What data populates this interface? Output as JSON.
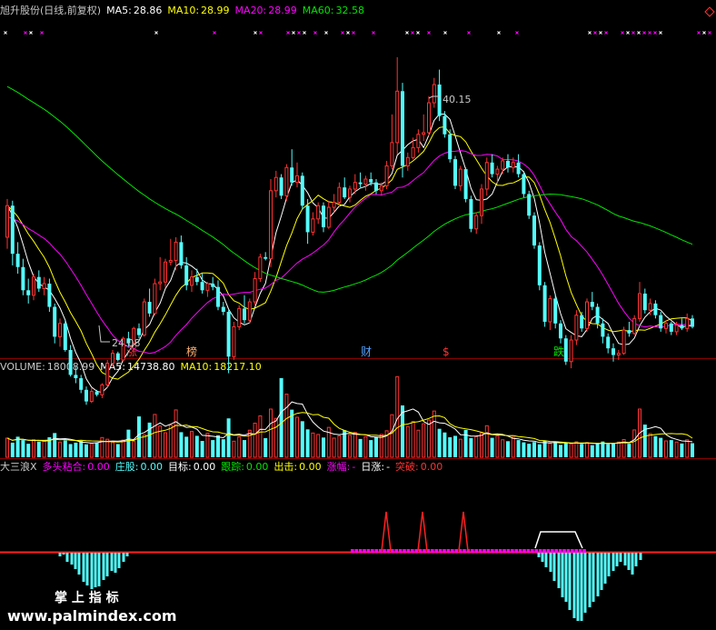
{
  "main": {
    "title": "旭升股份(日线,前复权)",
    "ma5_label": "MA5:",
    "ma5": "28.86",
    "ma10_label": "MA10:",
    "ma10": "28.99",
    "ma20_label": "MA20:",
    "ma20": "28.99",
    "ma60_label": "MA60:",
    "ma60": "32.58",
    "high_label": "40.15",
    "low_label": "24.08",
    "events": [
      "涨",
      "榜",
      "财",
      "$",
      "跌"
    ]
  },
  "volume": {
    "label": "VOLUME:",
    "value": "18008.99",
    "ma5_label": "MA5:",
    "ma5": "14738.80",
    "ma10_label": "MA10:",
    "ma10": "18217.10"
  },
  "indicator": {
    "name": "大三浪X",
    "items": [
      {
        "label": "多头粘合:",
        "value": "0.00"
      },
      {
        "label": "庄股:",
        "value": "0.00"
      },
      {
        "label": "目标:",
        "value": "0.00"
      },
      {
        "label": "跟踪:",
        "value": "0.00"
      },
      {
        "label": "出击:",
        "value": "0.00"
      },
      {
        "label": "涨幅:",
        "value": "-"
      },
      {
        "label": "日涨:",
        "value": "-"
      },
      {
        "label": "突破:",
        "value": "0.00"
      }
    ]
  },
  "watermark": {
    "line1": "掌 上 指 标",
    "line2": "www.palmindex.com"
  },
  "colors": {
    "up": "#ff3232",
    "down": "#54fcfc",
    "ma5": "#ffffff",
    "ma10": "#ffff00",
    "ma20": "#ff00ff",
    "ma60": "#00e600",
    "background": "#000000"
  },
  "chart_data": {
    "type": "candlestick",
    "ylim": [
      22.5,
      42.5
    ],
    "ma_periods": [
      5,
      10,
      20,
      60
    ],
    "candles": [
      [
        29.3,
        31.6,
        28.6,
        31.2
      ],
      [
        31.2,
        31.5,
        27.6,
        28.3
      ],
      [
        28.3,
        29.0,
        27.1,
        27.5
      ],
      [
        27.5,
        28.0,
        25.8,
        26.1
      ],
      [
        26.1,
        26.8,
        25.3,
        25.8
      ],
      [
        25.8,
        27.1,
        25.5,
        26.9
      ],
      [
        26.9,
        27.3,
        26.0,
        26.2
      ],
      [
        26.2,
        26.9,
        25.8,
        26.5
      ],
      [
        26.5,
        26.8,
        24.8,
        25.1
      ],
      [
        25.1,
        25.3,
        22.9,
        23.3
      ],
      [
        23.3,
        24.4,
        22.7,
        24.1
      ],
      [
        24.1,
        24.3,
        22.4,
        22.5
      ],
      [
        22.5,
        22.8,
        20.9,
        21.0
      ],
      [
        21.0,
        21.5,
        20.5,
        20.8
      ],
      [
        20.8,
        21.0,
        19.9,
        20.1
      ],
      [
        20.1,
        20.3,
        19.2,
        19.4
      ],
      [
        19.4,
        20.2,
        19.3,
        20.0
      ],
      [
        20.0,
        20.1,
        19.7,
        19.8
      ],
      [
        19.8,
        20.5,
        19.6,
        20.4
      ],
      [
        20.4,
        21.9,
        20.2,
        21.7
      ],
      [
        21.7,
        22.5,
        21.5,
        22.3
      ],
      [
        22.3,
        22.4,
        21.8,
        21.9
      ],
      [
        21.9,
        23.3,
        21.8,
        23.2
      ],
      [
        23.2,
        23.6,
        22.7,
        22.9
      ],
      [
        22.9,
        23.9,
        22.8,
        23.8
      ],
      [
        23.8,
        24.1,
        23.2,
        23.4
      ],
      [
        23.4,
        25.6,
        23.3,
        25.4
      ],
      [
        25.4,
        26.2,
        24.5,
        24.7
      ],
      [
        24.7,
        26.8,
        24.6,
        26.5
      ],
      [
        26.5,
        28.1,
        26.1,
        26.6
      ],
      [
        26.6,
        28.0,
        26.3,
        27.8
      ],
      [
        27.8,
        29.2,
        27.6,
        27.9
      ],
      [
        27.9,
        29.3,
        27.3,
        29.0
      ],
      [
        29.0,
        29.4,
        27.4,
        27.6
      ],
      [
        27.6,
        28.1,
        26.1,
        26.4
      ],
      [
        26.4,
        27.3,
        26.0,
        26.9
      ],
      [
        26.9,
        27.4,
        26.4,
        26.6
      ],
      [
        26.6,
        27.1,
        25.9,
        26.1
      ],
      [
        26.1,
        26.6,
        25.7,
        26.5
      ],
      [
        26.5,
        26.9,
        26.1,
        26.3
      ],
      [
        26.3,
        26.7,
        24.9,
        25.1
      ],
      [
        25.1,
        25.4,
        24.6,
        24.8
      ],
      [
        24.8,
        24.9,
        21.1,
        22.1
      ],
      [
        22.1,
        24.2,
        21.9,
        23.9
      ],
      [
        23.9,
        25.2,
        23.7,
        25.0
      ],
      [
        25.0,
        25.8,
        24.1,
        24.3
      ],
      [
        24.3,
        25.6,
        24.1,
        25.4
      ],
      [
        25.4,
        27.2,
        25.2,
        26.8
      ],
      [
        26.8,
        28.3,
        26.6,
        28.1
      ],
      [
        28.1,
        28.4,
        27.9,
        28.0
      ],
      [
        28.0,
        32.8,
        27.5,
        32.1
      ],
      [
        32.1,
        33.3,
        31.7,
        32.9
      ],
      [
        32.9,
        33.1,
        31.6,
        31.8
      ],
      [
        31.8,
        33.7,
        31.5,
        33.5
      ],
      [
        33.5,
        34.6,
        32.4,
        32.6
      ],
      [
        32.6,
        33.8,
        32.3,
        33.0
      ],
      [
        33.0,
        33.2,
        31.0,
        31.2
      ],
      [
        31.2,
        31.6,
        28.9,
        29.6
      ],
      [
        29.6,
        30.8,
        29.4,
        30.4
      ],
      [
        30.4,
        31.4,
        30.1,
        31.2
      ],
      [
        31.2,
        31.4,
        29.6,
        29.9
      ],
      [
        29.9,
        31.5,
        29.8,
        31.1
      ],
      [
        31.1,
        31.9,
        30.8,
        31.4
      ],
      [
        31.4,
        32.6,
        31.1,
        32.3
      ],
      [
        32.3,
        32.9,
        31.6,
        31.7
      ],
      [
        31.7,
        32.4,
        31.4,
        32.2
      ],
      [
        32.2,
        33.1,
        31.9,
        32.6
      ],
      [
        32.6,
        33.2,
        32.3,
        32.5
      ],
      [
        32.5,
        33.0,
        32.1,
        32.8
      ],
      [
        32.8,
        33.2,
        32.4,
        32.6
      ],
      [
        32.6,
        32.8,
        31.9,
        32.1
      ],
      [
        32.1,
        32.6,
        31.8,
        32.4
      ],
      [
        32.4,
        33.9,
        32.2,
        33.6
      ],
      [
        33.6,
        36.7,
        33.4,
        35.0
      ],
      [
        35.0,
        40.15,
        34.3,
        38.1
      ],
      [
        38.1,
        38.6,
        32.9,
        33.6
      ],
      [
        33.6,
        34.4,
        33.3,
        34.1
      ],
      [
        34.1,
        35.3,
        34.0,
        34.7
      ],
      [
        34.7,
        35.8,
        34.4,
        35.5
      ],
      [
        35.5,
        36.7,
        35.1,
        35.6
      ],
      [
        35.6,
        37.8,
        35.4,
        37.4
      ],
      [
        37.4,
        38.9,
        37.1,
        38.5
      ],
      [
        38.5,
        39.4,
        36.3,
        36.6
      ],
      [
        36.6,
        36.9,
        35.3,
        35.5
      ],
      [
        35.5,
        35.8,
        33.8,
        34.0
      ],
      [
        34.0,
        34.2,
        32.2,
        32.4
      ],
      [
        32.4,
        33.6,
        32.1,
        33.4
      ],
      [
        33.4,
        33.5,
        31.4,
        31.6
      ],
      [
        31.6,
        31.8,
        29.6,
        29.8
      ],
      [
        29.8,
        30.8,
        29.5,
        30.6
      ],
      [
        30.6,
        32.5,
        30.1,
        32.2
      ],
      [
        32.2,
        34.1,
        31.8,
        33.8
      ],
      [
        33.8,
        34.3,
        32.9,
        33.1
      ],
      [
        33.1,
        33.6,
        32.5,
        33.4
      ],
      [
        33.4,
        34.1,
        33.1,
        33.9
      ],
      [
        33.9,
        34.3,
        33.2,
        33.5
      ],
      [
        33.5,
        34.1,
        33.2,
        33.8
      ],
      [
        33.8,
        34.3,
        32.9,
        33.1
      ],
      [
        33.1,
        33.3,
        31.7,
        31.9
      ],
      [
        31.9,
        32.1,
        30.4,
        30.6
      ],
      [
        30.6,
        30.8,
        28.6,
        28.8
      ],
      [
        28.8,
        29.0,
        26.1,
        26.4
      ],
      [
        26.4,
        26.6,
        23.9,
        24.2
      ],
      [
        24.2,
        25.8,
        23.7,
        25.6
      ],
      [
        25.6,
        25.9,
        23.8,
        24.1
      ],
      [
        24.1,
        24.3,
        22.9,
        23.2
      ],
      [
        23.2,
        23.4,
        21.6,
        21.8
      ],
      [
        21.8,
        23.4,
        21.4,
        23.1
      ],
      [
        23.1,
        24.9,
        22.8,
        24.6
      ],
      [
        24.6,
        24.8,
        23.6,
        23.8
      ],
      [
        23.8,
        25.6,
        23.6,
        25.4
      ],
      [
        25.4,
        26.0,
        24.9,
        25.1
      ],
      [
        25.1,
        25.3,
        23.8,
        24.1
      ],
      [
        24.1,
        24.4,
        22.9,
        23.3
      ],
      [
        23.3,
        23.5,
        22.3,
        22.6
      ],
      [
        22.6,
        22.9,
        21.8,
        22.2
      ],
      [
        22.2,
        22.5,
        21.9,
        22.3
      ],
      [
        22.3,
        23.9,
        22.2,
        23.7
      ],
      [
        23.7,
        24.2,
        23.3,
        23.5
      ],
      [
        23.5,
        24.6,
        23.4,
        24.4
      ],
      [
        24.4,
        26.6,
        24.2,
        25.9
      ],
      [
        25.9,
        26.2,
        24.7,
        24.9
      ],
      [
        24.9,
        25.6,
        24.6,
        25.3
      ],
      [
        25.3,
        25.5,
        24.4,
        24.6
      ],
      [
        24.6,
        24.8,
        23.6,
        23.8
      ],
      [
        23.8,
        24.3,
        23.5,
        24.1
      ],
      [
        24.1,
        24.2,
        23.4,
        23.6
      ],
      [
        23.6,
        24.2,
        23.4,
        24.0
      ],
      [
        24.0,
        24.4,
        23.7,
        23.8
      ],
      [
        23.8,
        24.7,
        23.6,
        24.4
      ],
      [
        24.4,
        24.6,
        23.8,
        23.9
      ]
    ],
    "volume": [
      6800,
      5200,
      7300,
      6100,
      4800,
      6200,
      5600,
      5900,
      7100,
      8600,
      5400,
      6000,
      4700,
      5200,
      5800,
      4600,
      4900,
      5300,
      7000,
      6400,
      5200,
      4700,
      6100,
      9800,
      5600,
      14500,
      7900,
      12300,
      15200,
      11100,
      8700,
      11400,
      16800,
      8900,
      7300,
      9200,
      7600,
      5800,
      8500,
      6100,
      7800,
      6400,
      13800,
      5700,
      7200,
      6100,
      9600,
      12100,
      14700,
      6800,
      17100,
      13800,
      28100,
      22400,
      16900,
      14200,
      12800,
      9900,
      8600,
      8100,
      7000,
      10600,
      6800,
      7600,
      9600,
      7800,
      8800,
      6500,
      7300,
      6100,
      7200,
      8100,
      9400,
      15100,
      28600,
      18400,
      10900,
      12700,
      9600,
      11900,
      13200,
      16400,
      10100,
      8800,
      7100,
      7600,
      6400,
      9700,
      6800,
      7300,
      8600,
      11200,
      6900,
      7600,
      6200,
      5700,
      7100,
      6100,
      5300,
      4800,
      5400,
      4600,
      5900,
      4900,
      5600,
      4400,
      5100,
      4800,
      5500,
      4700,
      5200,
      4300,
      4900,
      5600,
      4700,
      5000,
      5400,
      6300,
      4800,
      9700,
      17100,
      11600,
      8400,
      7500,
      6900,
      5800,
      6100,
      5400,
      4900,
      6200,
      5000
    ],
    "indicator": {
      "bars_blue": [
        [
          66,
          4
        ],
        [
          70,
          2
        ],
        [
          74,
          10
        ],
        [
          79,
          13
        ],
        [
          83,
          18
        ],
        [
          87,
          24
        ],
        [
          92,
          32
        ],
        [
          96,
          36
        ],
        [
          101,
          40
        ],
        [
          105,
          38
        ],
        [
          109,
          37
        ],
        [
          114,
          30
        ],
        [
          118,
          26
        ],
        [
          123,
          20
        ],
        [
          127,
          22
        ],
        [
          131,
          17
        ],
        [
          136,
          10
        ],
        [
          140,
          4
        ],
        [
          593,
          5
        ],
        [
          597,
          10
        ],
        [
          601,
          16
        ],
        [
          606,
          21
        ],
        [
          610,
          31
        ],
        [
          615,
          39
        ],
        [
          619,
          49
        ],
        [
          623,
          54
        ],
        [
          627,
          63
        ],
        [
          632,
          72
        ],
        [
          636,
          75
        ],
        [
          640,
          75
        ],
        [
          644,
          66
        ],
        [
          649,
          60
        ],
        [
          653,
          54
        ],
        [
          658,
          48
        ],
        [
          662,
          41
        ],
        [
          666,
          34
        ],
        [
          670,
          26
        ],
        [
          675,
          20
        ],
        [
          679,
          15
        ],
        [
          683,
          10
        ],
        [
          688,
          14
        ],
        [
          692,
          19
        ],
        [
          696,
          24
        ],
        [
          700,
          15
        ],
        [
          705,
          8
        ]
      ],
      "white_line": [
        [
          589,
          603
        ],
        [
          595,
          585
        ],
        [
          633,
          585
        ],
        [
          641,
          603
        ]
      ],
      "magenta_range": [
        386,
        642
      ],
      "red_spikes": [
        425,
        465,
        510
      ]
    }
  }
}
